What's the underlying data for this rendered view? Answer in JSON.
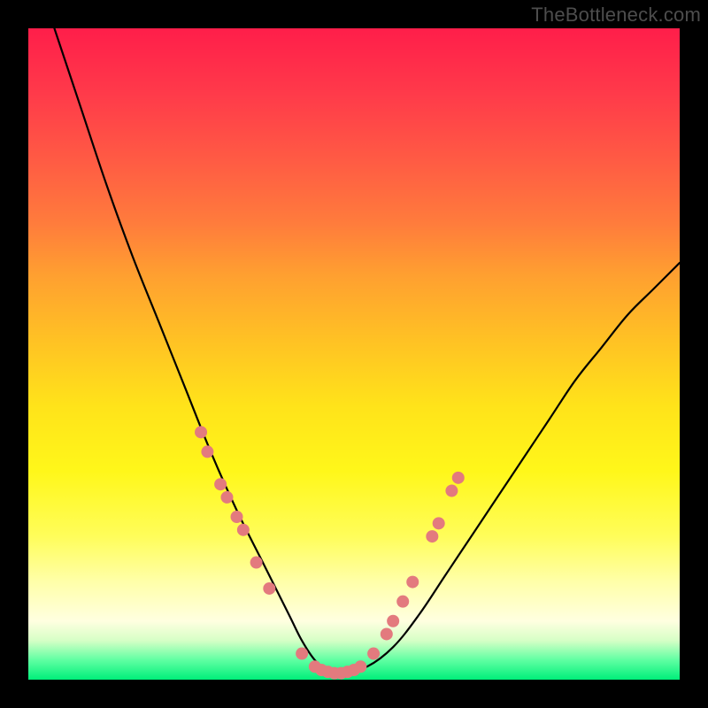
{
  "watermark": "TheBottleneck.com",
  "colors": {
    "curve_stroke": "#000000",
    "dot_fill": "#e37a7e",
    "dot_stroke": "#c0575a",
    "frame": "#000000"
  },
  "chart_data": {
    "type": "line",
    "title": "",
    "xlabel": "",
    "ylabel": "",
    "xlim": [
      0,
      100
    ],
    "ylim": [
      0,
      100
    ],
    "note": "Axes are unlabeled; values are normalized 0-100 estimates read from pixel positions. y=100 is top (worst/red), y=0 is bottom (best/green).",
    "series": [
      {
        "name": "bottleneck-curve",
        "x": [
          4,
          8,
          12,
          16,
          20,
          24,
          28,
          32,
          36,
          40,
          42,
          44,
          46,
          48,
          52,
          56,
          60,
          64,
          68,
          72,
          76,
          80,
          84,
          88,
          92,
          96,
          100
        ],
        "y": [
          100,
          88,
          76,
          65,
          55,
          45,
          35,
          26,
          18,
          10,
          6,
          3,
          1.5,
          1,
          2,
          5,
          10,
          16,
          22,
          28,
          34,
          40,
          46,
          51,
          56,
          60,
          64
        ]
      }
    ],
    "markers": [
      {
        "name": "highlight-dots",
        "points": [
          {
            "x": 26.5,
            "y": 38
          },
          {
            "x": 27.5,
            "y": 35
          },
          {
            "x": 29.5,
            "y": 30
          },
          {
            "x": 30.5,
            "y": 28
          },
          {
            "x": 32.0,
            "y": 25
          },
          {
            "x": 33.0,
            "y": 23
          },
          {
            "x": 35.0,
            "y": 18
          },
          {
            "x": 37.0,
            "y": 14
          },
          {
            "x": 42.0,
            "y": 4
          },
          {
            "x": 44.0,
            "y": 2
          },
          {
            "x": 45.0,
            "y": 1.5
          },
          {
            "x": 46.0,
            "y": 1.2
          },
          {
            "x": 47.0,
            "y": 1
          },
          {
            "x": 48.0,
            "y": 1
          },
          {
            "x": 49.0,
            "y": 1.2
          },
          {
            "x": 50.0,
            "y": 1.5
          },
          {
            "x": 51.0,
            "y": 2
          },
          {
            "x": 53.0,
            "y": 4
          },
          {
            "x": 55.0,
            "y": 7
          },
          {
            "x": 56.0,
            "y": 9
          },
          {
            "x": 57.5,
            "y": 12
          },
          {
            "x": 59.0,
            "y": 15
          },
          {
            "x": 62.0,
            "y": 22
          },
          {
            "x": 63.0,
            "y": 24
          },
          {
            "x": 65.0,
            "y": 29
          },
          {
            "x": 66.0,
            "y": 31
          }
        ]
      }
    ]
  }
}
